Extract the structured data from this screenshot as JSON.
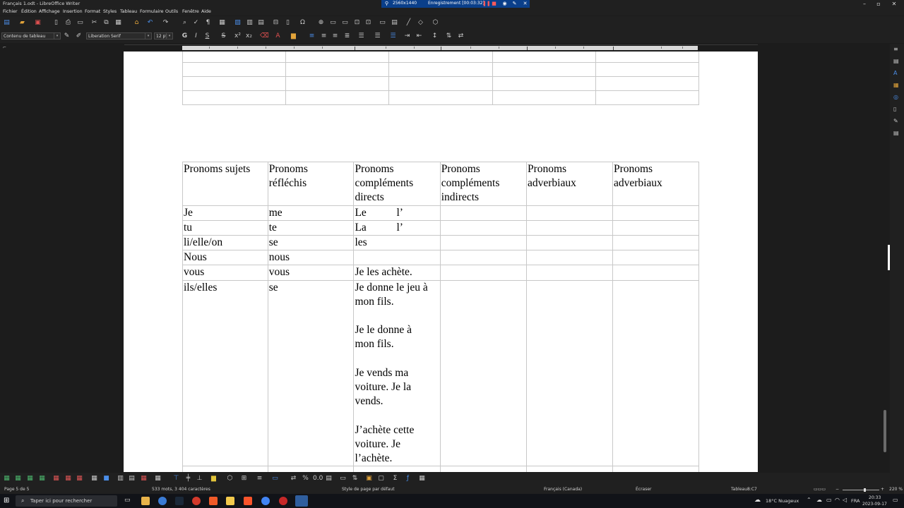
{
  "window": {
    "title": "Français 1.odt - LibreOffice Writer"
  },
  "recording": {
    "resolution": "2560x1440",
    "label": "Enregistrement [00:03:32]"
  },
  "menu": [
    "Fichier",
    "Édition",
    "Affichage",
    "Insertion",
    "Format",
    "Styles",
    "Tableau",
    "Formulaire",
    "Outils",
    "Fenêtre",
    "Aide"
  ],
  "formatting": {
    "paragraph_style": "Contenu de tableau",
    "font_name": "Liberation Serif",
    "font_size": "12 pt"
  },
  "table": {
    "headers": [
      "Pronoms sujets",
      "Pronoms\nréfléchis",
      "Pronoms\ncompléments\ndirects",
      "Pronoms\ncompléments\nindirects",
      "Pronoms\nadverbiaux",
      "Pronoms\nadverbiaux"
    ],
    "rows": [
      [
        "Je",
        "me",
        "Le           l’",
        "",
        "",
        ""
      ],
      [
        "tu",
        "te",
        "La           l’",
        "",
        "",
        ""
      ],
      [
        "li/elle/on",
        "se",
        "les",
        "",
        "",
        ""
      ],
      [
        "Nous",
        "nous",
        "",
        "",
        "",
        ""
      ],
      [
        "vous",
        "vous",
        "Je les achète.",
        "",
        "",
        ""
      ],
      [
        "ils/elles",
        "se",
        "Je donne le jeu à\nmon fils.\n\nJe le donne à\nmon fils.\n\nJe vends ma\nvoiture. Je la\nvends.\n\nJ’achète cette\nvoiture. Je\nl’achète.",
        "",
        "",
        ""
      ]
    ]
  },
  "status": {
    "page": "Page 5 de 5",
    "words": "533 mots, 3 404 caractères",
    "page_style": "Style de page par défaut",
    "language": "Français (Canada)",
    "mode": "Écraser",
    "cell": "Tableau8:C7",
    "zoom": "220 %"
  },
  "taskbar": {
    "search_placeholder": "Taper ici pour rechercher",
    "weather": "18°C  Nuageux",
    "lang": "FRA",
    "time": "20:33",
    "date": "2023-09-17"
  }
}
